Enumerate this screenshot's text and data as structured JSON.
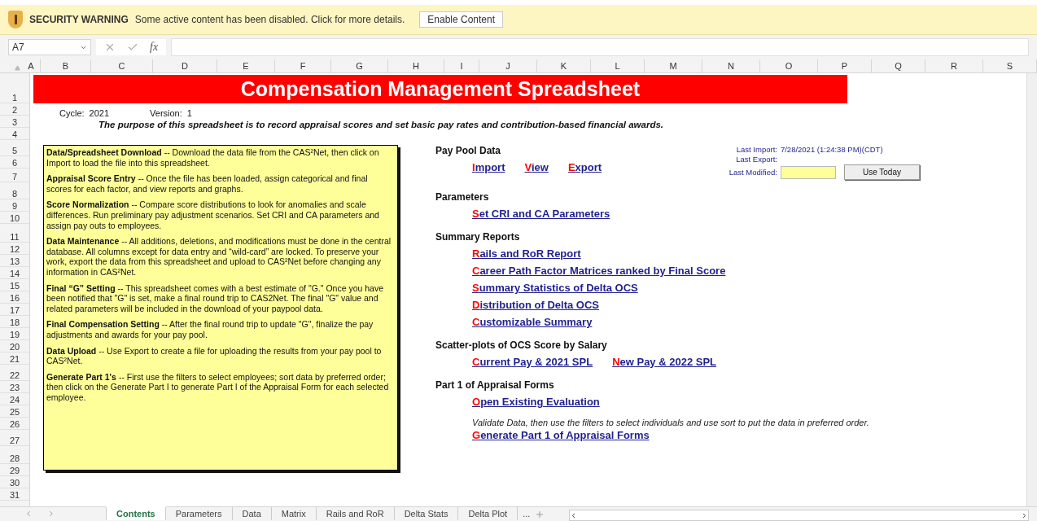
{
  "security_bar": {
    "label": "SECURITY WARNING",
    "message": "Some active content has been disabled. Click for more details.",
    "button": "Enable Content"
  },
  "formula_bar": {
    "name_box": "A7",
    "fx": "fx"
  },
  "columns": [
    "A",
    "B",
    "C",
    "D",
    "E",
    "F",
    "G",
    "H",
    "I",
    "J",
    "K",
    "L",
    "M",
    "N",
    "O",
    "P",
    "Q",
    "R",
    "S"
  ],
  "rows": [
    "1",
    "2",
    "3",
    "4",
    "5",
    "6",
    "7",
    "8",
    "9",
    "10",
    "11",
    "12",
    "13",
    "14",
    "15",
    "16",
    "17",
    "18",
    "19",
    "20",
    "21",
    "22",
    "23",
    "24",
    "25",
    "26",
    "27",
    "28",
    "29",
    "30",
    "31"
  ],
  "sheet": {
    "title": "Compensation Management Spreadsheet",
    "cycle_label": "Cycle:",
    "cycle": "2021",
    "version_label": "Version:",
    "version": "1",
    "purpose": "The purpose of this spreadsheet is to record appraisal scores and set basic pay rates and contribution-based financial awards.",
    "instructions": [
      "**Data/Spreadsheet Download** -- Download the data file from the CAS²Net, then click on Import to load the file into this spreadsheet.",
      "**Appraisal Score Entry** -- Once the file has been loaded, assign categorical and final scores for each factor, and view reports and graphs.",
      "**Score Normalization** -- Compare score distributions to look for anomalies and  scale differences.   Run preliminary pay adjustment scenarios.  Set CRI and CA parameters and assign pay outs to employees.",
      "**Data Maintenance** -- All additions, deletions, and modifications must be done in the central database.  All columns except for data entry and  “wild-card”  are locked.  To preserve your work, export the data from this spreadsheet and upload to CAS²Net before changing any information in CAS²Net.",
      "**Final “G” Setting** -- This spreadsheet comes with a best estimate of \"G.\" Once you have been notified that \"G\" is set, make a final round trip to CAS2Net. The final \"G\" value and related parameters will be included in the download of your paypool data.",
      "**Final Compensation Setting** -- After the final round trip to update \"G\", finalize the pay adjustments and awards for your pay pool.",
      "**Data Upload** -- Use Export to create a file for uploading the results from your pay pool to CAS²Net.",
      "**Generate Part 1's** -- First use the filters to select employees; sort data by preferred order; then click on the Generate Part I to generate Part I of the Appraisal Form for each selected employee."
    ],
    "import_panel": {
      "last_import_label": "Last Import:",
      "last_import": "7/28/2021 (1:24:38 PM)(CDT)",
      "last_export_label": "Last Export:",
      "last_modified_label": "Last Modified:",
      "button": "Use Today"
    },
    "sections": [
      {
        "heading": "Pay Pool Data",
        "rows": [
          {
            "kind": "links",
            "links": [
              "Import",
              "View",
              "Export"
            ]
          }
        ]
      },
      {
        "heading": "Parameters",
        "rows": [
          {
            "kind": "links",
            "links": [
              "Set CRI and CA Parameters"
            ]
          }
        ]
      },
      {
        "heading": "Summary Reports",
        "rows": [
          {
            "kind": "links",
            "links": [
              "Rails and RoR Report"
            ]
          },
          {
            "kind": "links",
            "links": [
              "Career Path Factor Matrices ranked by Final Score"
            ]
          },
          {
            "kind": "links",
            "links": [
              "Summary Statistics of Delta OCS"
            ]
          },
          {
            "kind": "links",
            "links": [
              "Distribution of Delta OCS"
            ]
          },
          {
            "kind": "links",
            "links": [
              "Customizable Summary"
            ]
          }
        ]
      },
      {
        "heading": "Scatter-plots of OCS Score by Salary",
        "rows": [
          {
            "kind": "links",
            "links": [
              "Current Pay & 2021 SPL",
              "New Pay & 2022 SPL"
            ]
          }
        ]
      },
      {
        "heading": "Part 1 of Appraisal Forms",
        "rows": [
          {
            "kind": "links",
            "links": [
              "Open Existing Evaluation"
            ]
          },
          {
            "kind": "note",
            "text": "Validate Data, then use the filters to select individuals and use sort to put the data in preferred order."
          },
          {
            "kind": "links",
            "links": [
              "Generate Part 1 of Appraisal Forms"
            ]
          }
        ]
      }
    ]
  },
  "tabs": [
    {
      "label": "Contents",
      "selected": true
    },
    {
      "label": "Parameters",
      "selected": false
    },
    {
      "label": "Data",
      "selected": false
    },
    {
      "label": "Matrix",
      "selected": false
    },
    {
      "label": "Rails and RoR",
      "selected": false
    },
    {
      "label": "Delta Stats",
      "selected": false
    },
    {
      "label": "Delta Plot",
      "selected": false
    }
  ],
  "tabs_more": "..."
}
